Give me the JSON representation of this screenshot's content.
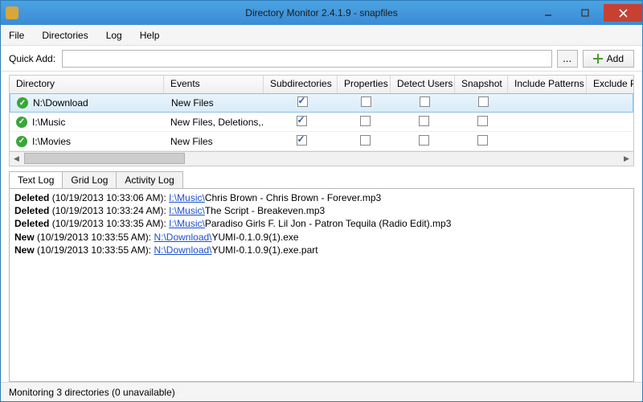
{
  "window": {
    "title": "Directory Monitor 2.4.1.9 - snapfiles"
  },
  "menu": {
    "file": "File",
    "directories": "Directories",
    "log": "Log",
    "help": "Help"
  },
  "toolbar": {
    "quickadd_label": "Quick Add:",
    "quickadd_value": "",
    "browse_label": "...",
    "add_label": "Add"
  },
  "grid": {
    "headers": {
      "directory": "Directory",
      "events": "Events",
      "subdirectories": "Subdirectories",
      "properties": "Properties",
      "detect_users": "Detect Users",
      "snapshot": "Snapshot",
      "include_patterns": "Include Patterns",
      "exclude_patterns": "Exclude Pattern"
    },
    "rows": [
      {
        "dir": "N:\\Download",
        "events": "New Files",
        "sub": true,
        "prop": false,
        "det": false,
        "snap": false,
        "selected": true
      },
      {
        "dir": "I:\\Music",
        "events": "New Files, Deletions,...",
        "sub": true,
        "prop": false,
        "det": false,
        "snap": false,
        "selected": false
      },
      {
        "dir": "I:\\Movies",
        "events": "New Files",
        "sub": true,
        "prop": false,
        "det": false,
        "snap": false,
        "selected": false
      }
    ]
  },
  "tabs": {
    "text_log": "Text Log",
    "grid_log": "Grid Log",
    "activity_log": "Activity Log"
  },
  "log": [
    {
      "kind": "Deleted",
      "ts": "(10/19/2013 10:33:06 AM):",
      "path": "I:\\Music\\",
      "file": "Chris Brown - Chris Brown - Forever.mp3"
    },
    {
      "kind": "Deleted",
      "ts": "(10/19/2013 10:33:24 AM):",
      "path": "I:\\Music\\",
      "file": "The Script - Breakeven.mp3"
    },
    {
      "kind": "Deleted",
      "ts": "(10/19/2013 10:33:35 AM):",
      "path": "I:\\Music\\",
      "file": "Paradiso Girls F. Lil Jon - Patron Tequila (Radio Edit).mp3"
    },
    {
      "kind": "New",
      "ts": "(10/19/2013 10:33:55 AM):",
      "path": "N:\\Download\\",
      "file": "YUMI-0.1.0.9(1).exe"
    },
    {
      "kind": "New",
      "ts": "(10/19/2013 10:33:55 AM):",
      "path": "N:\\Download\\",
      "file": "YUMI-0.1.0.9(1).exe.part"
    }
  ],
  "status": {
    "text": "Monitoring 3 directories (0 unavailable)"
  }
}
